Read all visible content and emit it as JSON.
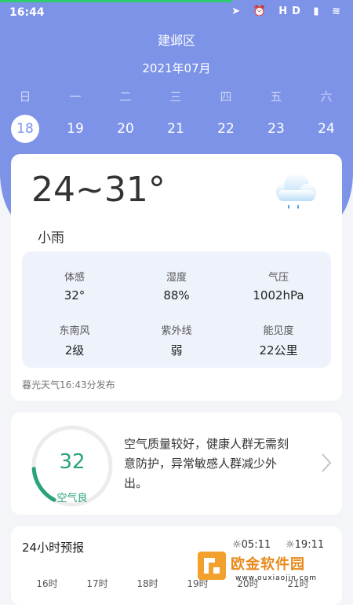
{
  "status_bar": {
    "time": "16:44",
    "icons": "➤ ⏰ HD ▮ ≋"
  },
  "header": {
    "district": "建邺区",
    "month": "2021年07月"
  },
  "calendar": {
    "weekdays": [
      "日",
      "一",
      "二",
      "三",
      "四",
      "五",
      "六"
    ],
    "dates": [
      "18",
      "19",
      "20",
      "21",
      "22",
      "23",
      "24"
    ],
    "selected": "18"
  },
  "weather": {
    "temp_range": "24~31°",
    "condition": "小雨",
    "icon": "cloud-rain-icon",
    "details": [
      {
        "label": "体感",
        "value": "32°"
      },
      {
        "label": "湿度",
        "value": "88%"
      },
      {
        "label": "气压",
        "value": "1002hPa"
      },
      {
        "label": "东南风",
        "value": "2级"
      },
      {
        "label": "紫外线",
        "value": "弱"
      },
      {
        "label": "能见度",
        "value": "22公里"
      }
    ],
    "publish": "暮光天气16:43分发布"
  },
  "air_quality": {
    "value": "32",
    "level": "空气良",
    "description": "空气质量较好，健康人群无需刻意防护，异常敏感人群减少外出。",
    "ring_fraction": 0.16
  },
  "forecast": {
    "title": "24小时预报",
    "sunrise": "05:11",
    "sunset": "19:11",
    "hours": [
      "16时",
      "17时",
      "18时",
      "19时",
      "20时",
      "21时"
    ]
  },
  "watermark": {
    "text": "欧金软件园",
    "url": "www.ouxiaojin.com"
  },
  "colors": {
    "accent": "#7d93e8",
    "aqi": "#2aa37a"
  }
}
